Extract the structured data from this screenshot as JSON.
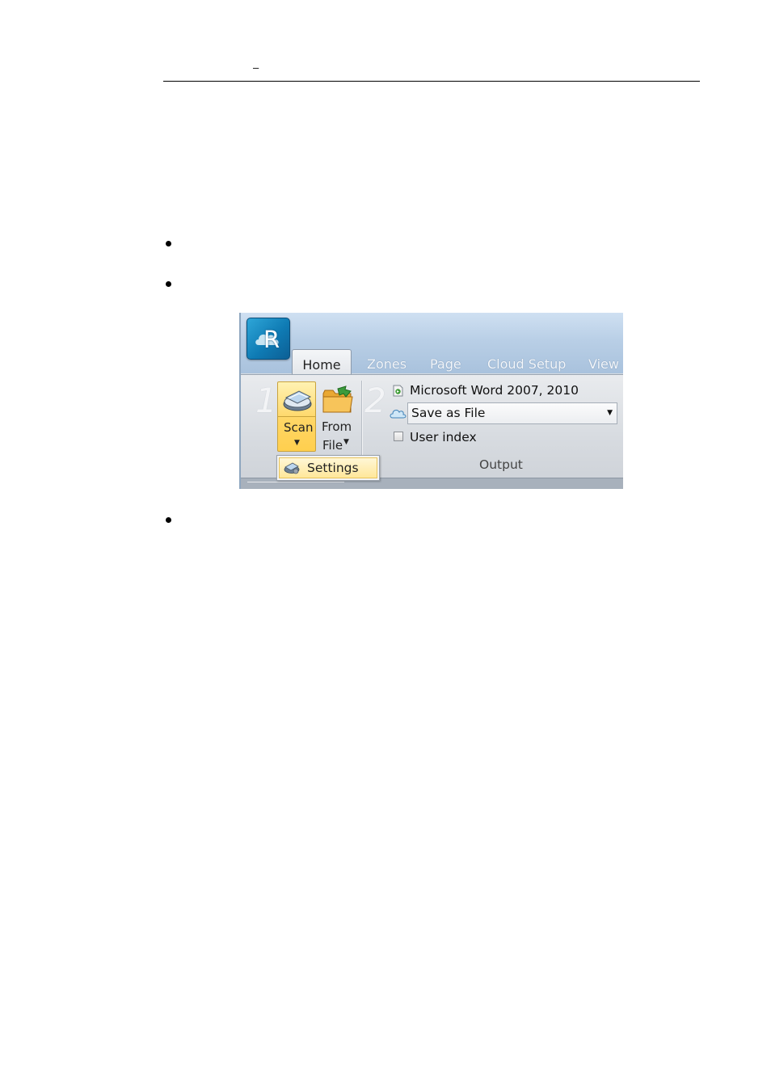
{
  "header": {
    "dash": "–"
  },
  "screenshot": {
    "logo_letter": "R",
    "tabs": [
      {
        "label": "Home",
        "active": true
      },
      {
        "label": "Zones",
        "active": false
      },
      {
        "label": "Page",
        "active": false
      },
      {
        "label": "Cloud Setup",
        "active": false
      },
      {
        "label": "View",
        "active": false
      }
    ],
    "step_numbers": [
      "1",
      "2"
    ],
    "scan_button": {
      "label": "Scan"
    },
    "from_file_button": {
      "label_line1": "From",
      "label_line2": "File"
    },
    "output_format": "Microsoft Word 2007, 2010",
    "destination": {
      "selected": "Save as File"
    },
    "user_index": {
      "label": "User index",
      "checked": false
    },
    "group_label": "Output",
    "scan_menu": {
      "items": [
        {
          "label": "Settings"
        }
      ]
    },
    "colors": {
      "highlight": "#ffd665",
      "ribbon": "#d7dbe0",
      "titlebar": "#b9cfe6",
      "logo": "#0f7bb4"
    }
  }
}
